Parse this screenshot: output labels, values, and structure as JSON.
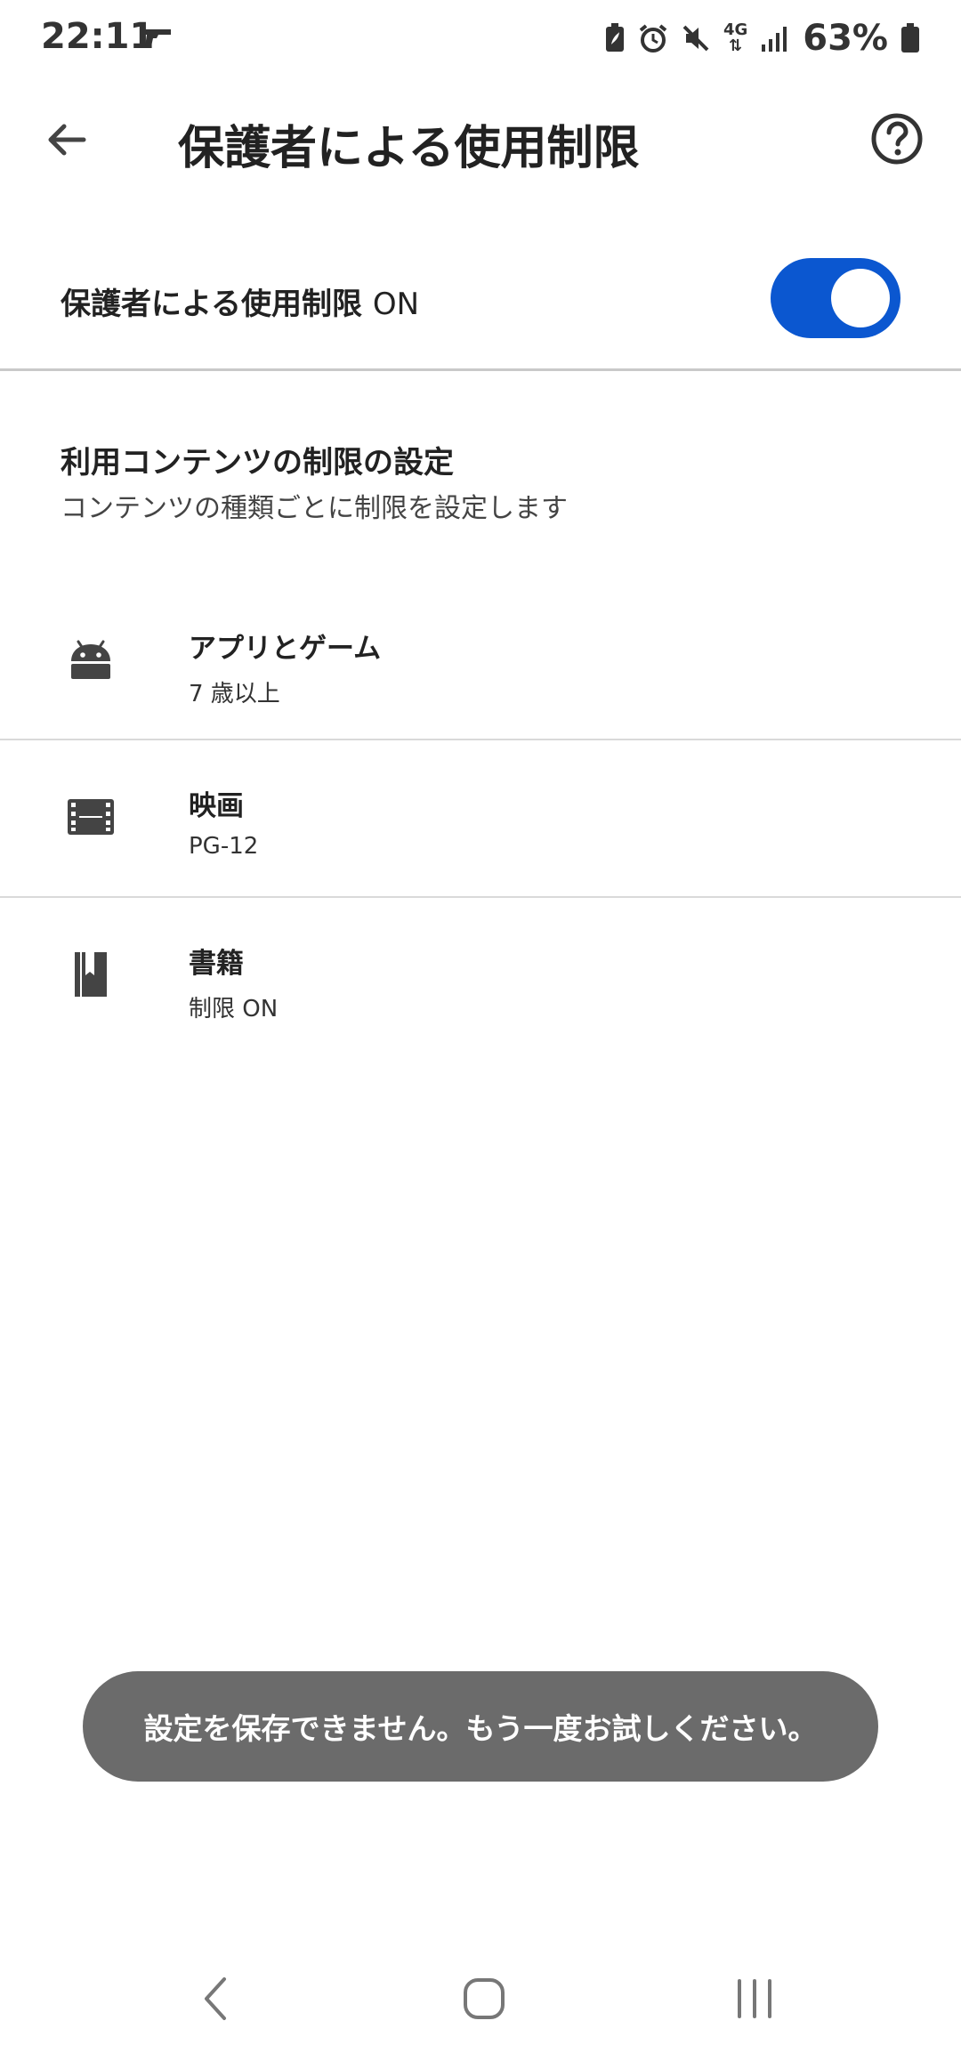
{
  "status_bar": {
    "time": "22:11",
    "network": "4G",
    "battery_percent": "63%"
  },
  "app_bar": {
    "title": "保護者による使用制限",
    "back_icon": "arrow-back-icon",
    "help_icon": "help-circle-icon"
  },
  "master_toggle": {
    "label": "保護者による使用制限",
    "state_text": "ON",
    "enabled": true,
    "accent_color": "#0b57d0"
  },
  "section": {
    "title": "利用コンテンツの制限の設定",
    "subtitle": "コンテンツの種類ごとに制限を設定します"
  },
  "items": [
    {
      "icon": "android-icon",
      "title": "アプリとゲーム",
      "value": "7 歳以上"
    },
    {
      "icon": "film-icon",
      "title": "映画",
      "value": "PG-12"
    },
    {
      "icon": "book-icon",
      "title": "書籍",
      "value": "制限 ON"
    }
  ],
  "snackbar": {
    "message": "設定を保存できません。もう一度お試しください。"
  },
  "nav_bar": {
    "back_icon": "nav-back-icon",
    "home_icon": "nav-home-icon",
    "recents_icon": "nav-recents-icon"
  }
}
